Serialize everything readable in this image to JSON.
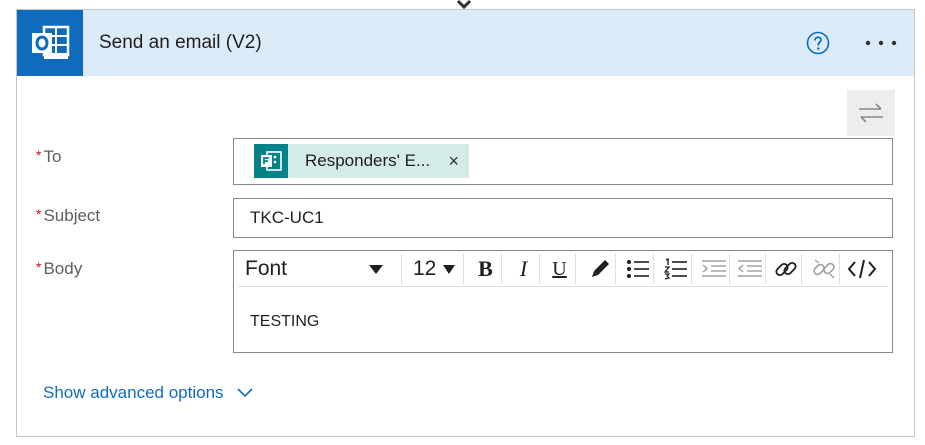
{
  "action": {
    "title": "Send an email (V2)",
    "app_icon": "outlook-icon",
    "help_icon": "help-circle-icon",
    "more_icon": "more-options-icon",
    "accent_color": "#0f6cbd",
    "header_bg": "#dcebf8"
  },
  "fields": {
    "required_marker": "*",
    "to": {
      "label": "To",
      "token": {
        "label": "Responders' E...",
        "icon": "forms-icon",
        "close": "×"
      }
    },
    "subject": {
      "label": "Subject",
      "value": "TKC-UC1"
    },
    "body": {
      "label": "Body",
      "toolbar": {
        "font": "Font",
        "size": "12",
        "bold": "B",
        "italic": "I",
        "underline": "U"
      },
      "content": "TESTING"
    }
  },
  "advanced_options": {
    "label": "Show advanced options"
  }
}
